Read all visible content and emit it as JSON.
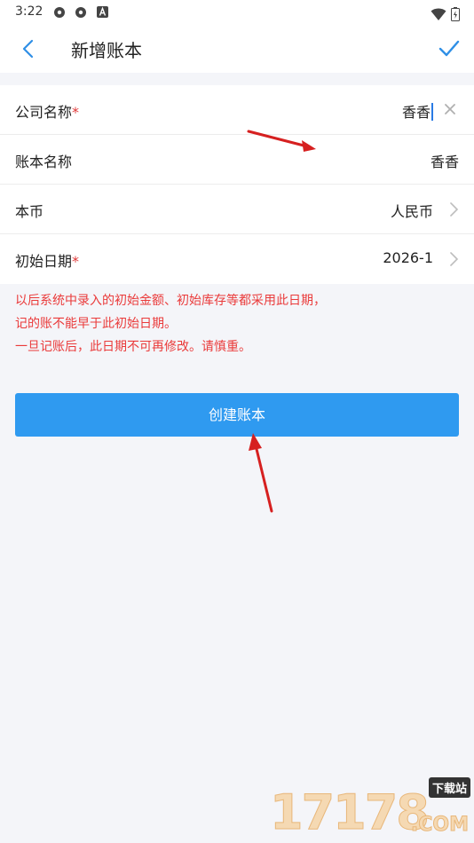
{
  "status_bar": {
    "time": "3:22",
    "icons": [
      "app-icon",
      "app-icon",
      "a-icon"
    ],
    "right_icons": [
      "wifi-icon",
      "battery-icon"
    ]
  },
  "header": {
    "title": "新增账本",
    "back_icon": "chevron-left-icon",
    "confirm_icon": "check-icon"
  },
  "form": {
    "rows": [
      {
        "label": "公司名称",
        "required": "*",
        "value": "香香",
        "trailing": "clear-icon"
      },
      {
        "label": "账本名称",
        "required": "",
        "value": "香香",
        "trailing": ""
      },
      {
        "label": "本币",
        "required": "",
        "value": "人民币",
        "trailing": "chevron-right-icon"
      },
      {
        "label": "初始日期",
        "required": "*",
        "value": "2026-1",
        "trailing": "chevron-right-icon"
      }
    ]
  },
  "notice": {
    "lines": [
      "以后系统中录入的初始金额、初始库存等都采用此日期，",
      "记的账不能早于此初始日期。",
      "一旦记账后，此日期不可再修改。请慎重。"
    ]
  },
  "create_button": {
    "label": "创建账本"
  },
  "watermark": {
    "number": "17178",
    "tag": "下载站",
    "suffix": ".COM"
  },
  "colors": {
    "accent": "#2f9af0",
    "warning_text": "#ea3a3a",
    "background": "#f4f5f9"
  }
}
